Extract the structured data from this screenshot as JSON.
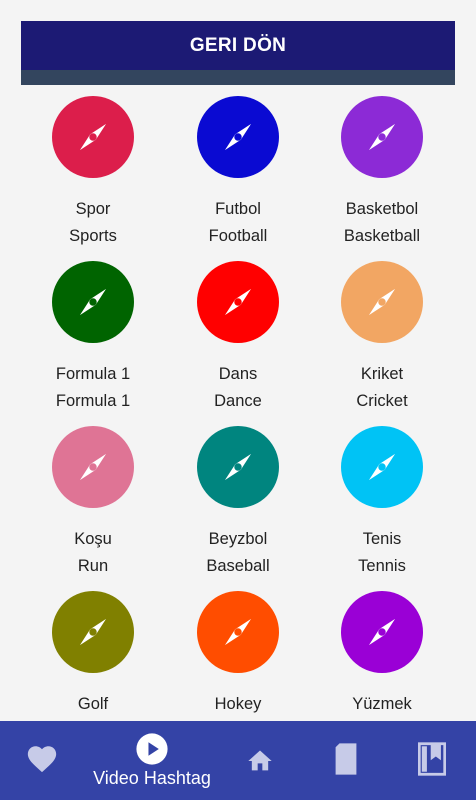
{
  "header": {
    "back_label": "GERI DÖN"
  },
  "categories": [
    {
      "tr": "Spor",
      "en": "Sports",
      "color": "#dc1e4b"
    },
    {
      "tr": "Futbol",
      "en": "Football",
      "color": "#0a0ad2"
    },
    {
      "tr": "Basketbol",
      "en": "Basketball",
      "color": "#8c2ad6"
    },
    {
      "tr": "Formula 1",
      "en": "Formula 1",
      "color": "#006400"
    },
    {
      "tr": "Dans",
      "en": "Dance",
      "color": "#ff0000"
    },
    {
      "tr": "Kriket",
      "en": "Cricket",
      "color": "#f2a663"
    },
    {
      "tr": "Koşu",
      "en": "Run",
      "color": "#df7495"
    },
    {
      "tr": "Beyzbol",
      "en": "Baseball",
      "color": "#00857f"
    },
    {
      "tr": "Tenis",
      "en": "Tennis",
      "color": "#00c3f5"
    },
    {
      "tr": "Golf",
      "en": "",
      "color": "#808000"
    },
    {
      "tr": "Hokey",
      "en": "",
      "color": "#ff4d00"
    },
    {
      "tr": "Yüzmek",
      "en": "",
      "color": "#9a00d6"
    }
  ],
  "bottom_nav": {
    "active_label": "Video Hashtag",
    "items": [
      {
        "icon": "heart-icon"
      },
      {
        "icon": "play-circle-icon"
      },
      {
        "icon": "home-icon"
      },
      {
        "icon": "card-icon"
      },
      {
        "icon": "bookmark-book-icon"
      }
    ]
  }
}
